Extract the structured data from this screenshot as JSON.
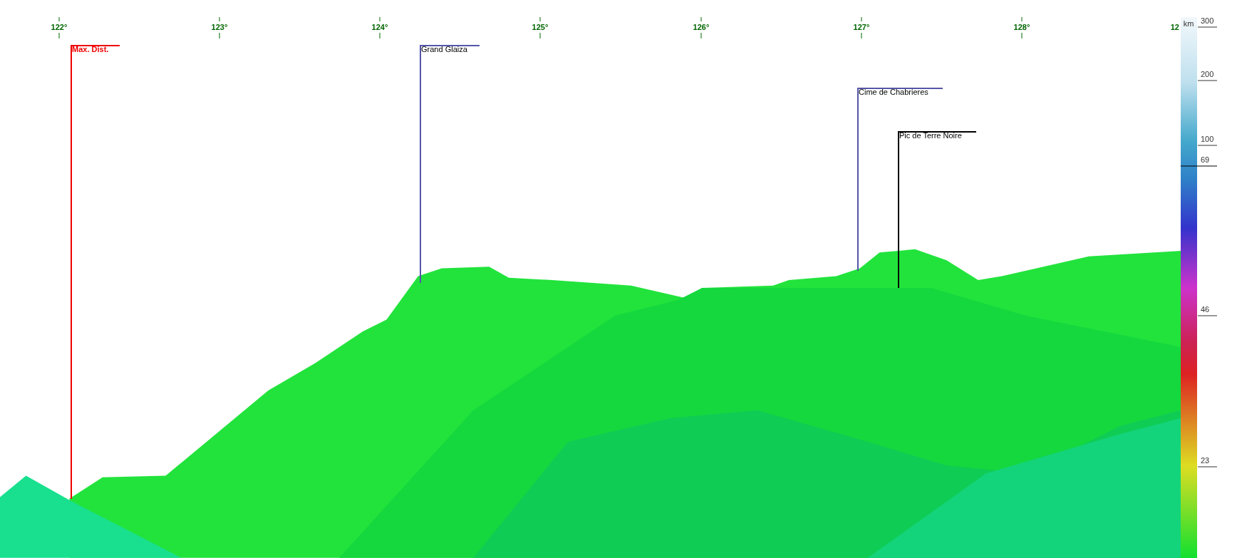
{
  "azimuth_axis": {
    "ticks": [
      "122°",
      "123°",
      "124°",
      "125°",
      "126°",
      "127°",
      "128°",
      "12"
    ]
  },
  "markers": [
    {
      "label": "Max. Dist.",
      "color": "#ee0000",
      "kind": "limit"
    },
    {
      "label": "Grand Glaiza",
      "color": "#5555aa",
      "kind": "peak"
    },
    {
      "label": "Cime de Chabrieres",
      "color": "#5555aa",
      "kind": "peak"
    },
    {
      "label": "Pic de Terre Noire",
      "color": "#000000",
      "kind": "peak"
    }
  ],
  "distance_scale": {
    "unit": "km",
    "labels": [
      {
        "text": "300",
        "kind": "tick"
      },
      {
        "text": "200",
        "kind": "tick"
      },
      {
        "text": "100",
        "kind": "tick"
      },
      {
        "text": "69",
        "kind": "limit"
      },
      {
        "text": "46",
        "kind": "tick"
      },
      {
        "text": "23",
        "kind": "tick"
      }
    ]
  }
}
